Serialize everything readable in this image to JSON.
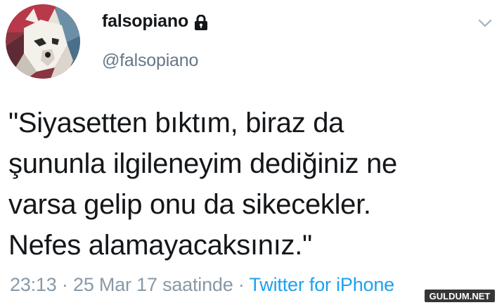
{
  "tweet": {
    "user": {
      "display_name": "falsopiano",
      "handle": "@falsopiano",
      "locked_icon": "lock-icon",
      "avatar": "wolf-avatar"
    },
    "text": "\"Siyasetten bıktım, biraz da\nşununla ilgileneyim dediğiniz ne\nvarsa gelip onu da sikecekler.\nNefes alamayacaksınız.\"",
    "time": "23:13",
    "separator": "·",
    "date_text": "25 Mar 17 saatinde",
    "source": "Twitter for iPhone",
    "menu_icon": "chevron-down-icon"
  },
  "watermark": {
    "text": "GULDUM.NET"
  },
  "colors": {
    "text": "#14171a",
    "secondary": "#657786",
    "meta": "#8899a6",
    "link": "#1da1f2"
  }
}
